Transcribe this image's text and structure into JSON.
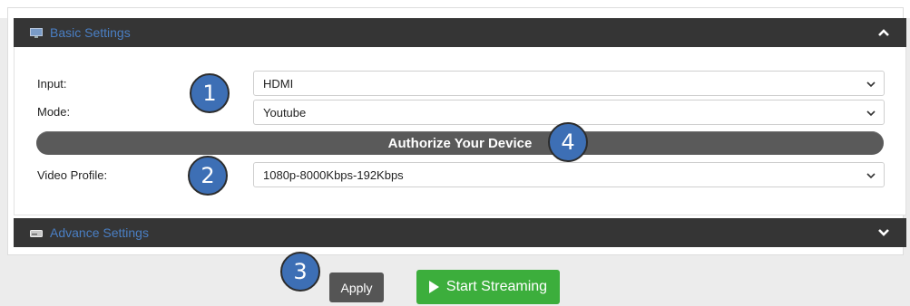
{
  "basic_settings": {
    "title": "Basic Settings",
    "icon": "monitor-icon",
    "collapse_icon": "chevron-up-icon"
  },
  "fields": {
    "input": {
      "label": "Input:",
      "value": "HDMI"
    },
    "mode": {
      "label": "Mode:",
      "value": "Youtube"
    },
    "authorize_label": "Authorize Your Device",
    "video_profile": {
      "label": "Video Profile:",
      "value": "1080p-8000Kbps-192Kbps"
    }
  },
  "advance_settings": {
    "title": "Advance Settings",
    "icon": "hard-drive-icon",
    "expand_icon": "chevron-down-icon"
  },
  "actions": {
    "apply_label": "Apply",
    "start_streaming_label": "Start Streaming"
  },
  "badges": [
    "1",
    "2",
    "3",
    "4"
  ],
  "colors": {
    "header_bg": "#353535",
    "header_text": "#4a7fc4",
    "badge_bg": "#3d6fb5",
    "start_btn": "#3cae3c",
    "apply_btn": "#555555",
    "auth_bar": "#5a5a5a"
  }
}
